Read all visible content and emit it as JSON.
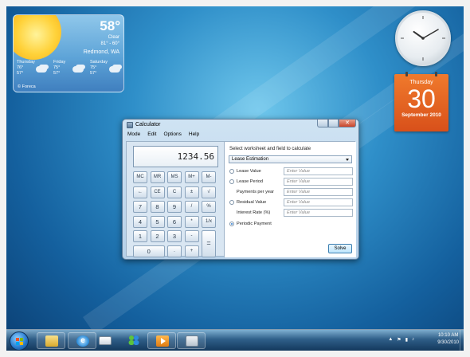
{
  "weather": {
    "temperature": "58°",
    "condition": "Clear",
    "range": "81° - 60°",
    "location": "Redmond, WA",
    "forecast": [
      {
        "day": "Thursday",
        "high": "76°",
        "low": "57°"
      },
      {
        "day": "Friday",
        "high": "75°",
        "low": "57°"
      },
      {
        "day": "Saturday",
        "high": "75°",
        "low": "57°"
      }
    ],
    "brand": "© Foreca"
  },
  "clock": {
    "hour": 10,
    "minute": 10
  },
  "calendar": {
    "weekday": "Thursday",
    "day": "30",
    "month_year": "September 2010"
  },
  "calculator": {
    "title": "Calculator",
    "menu": [
      "Mode",
      "Edit",
      "Options",
      "Help"
    ],
    "display": "1234.56",
    "keys": [
      [
        "MC",
        "MR",
        "MS",
        "M+",
        "M-"
      ],
      [
        "←",
        "CE",
        "C",
        "±",
        "√"
      ],
      [
        "7",
        "8",
        "9",
        "/",
        "%"
      ],
      [
        "4",
        "5",
        "6",
        "*",
        "1/x"
      ],
      [
        "1",
        "2",
        "3",
        "-",
        "="
      ],
      [
        "0",
        ".",
        "+"
      ]
    ],
    "panel": {
      "heading": "Select worksheet and field to calculate",
      "worksheet": "Lease Estimation",
      "fields": [
        {
          "label": "Lease Value",
          "radio": true,
          "checked": false,
          "placeholder": "Enter Value"
        },
        {
          "label": "Lease Period",
          "radio": true,
          "checked": false,
          "placeholder": "Enter Value"
        },
        {
          "label": "Payments per year",
          "radio": false,
          "checked": false,
          "placeholder": "Enter Value"
        },
        {
          "label": "Residual Value",
          "radio": true,
          "checked": false,
          "placeholder": "Enter Value"
        },
        {
          "label": "Interest Rate (%)",
          "radio": false,
          "checked": false,
          "placeholder": "Enter Value"
        },
        {
          "label": "Periodic Payment",
          "radio": true,
          "checked": true,
          "placeholder": ""
        }
      ],
      "solve_label": "Solve"
    }
  },
  "taskbar": {
    "items": [
      "windows-explorer",
      "internet-explorer",
      "windows-mail",
      "windows-live-messenger",
      "windows-media-player",
      "calculator"
    ],
    "time": "10:10 AM",
    "date": "9/30/2010"
  },
  "colors": {
    "accent": "#2b7fd0",
    "calendar": "#e0601f",
    "weather_sun": "#ffd23a"
  }
}
